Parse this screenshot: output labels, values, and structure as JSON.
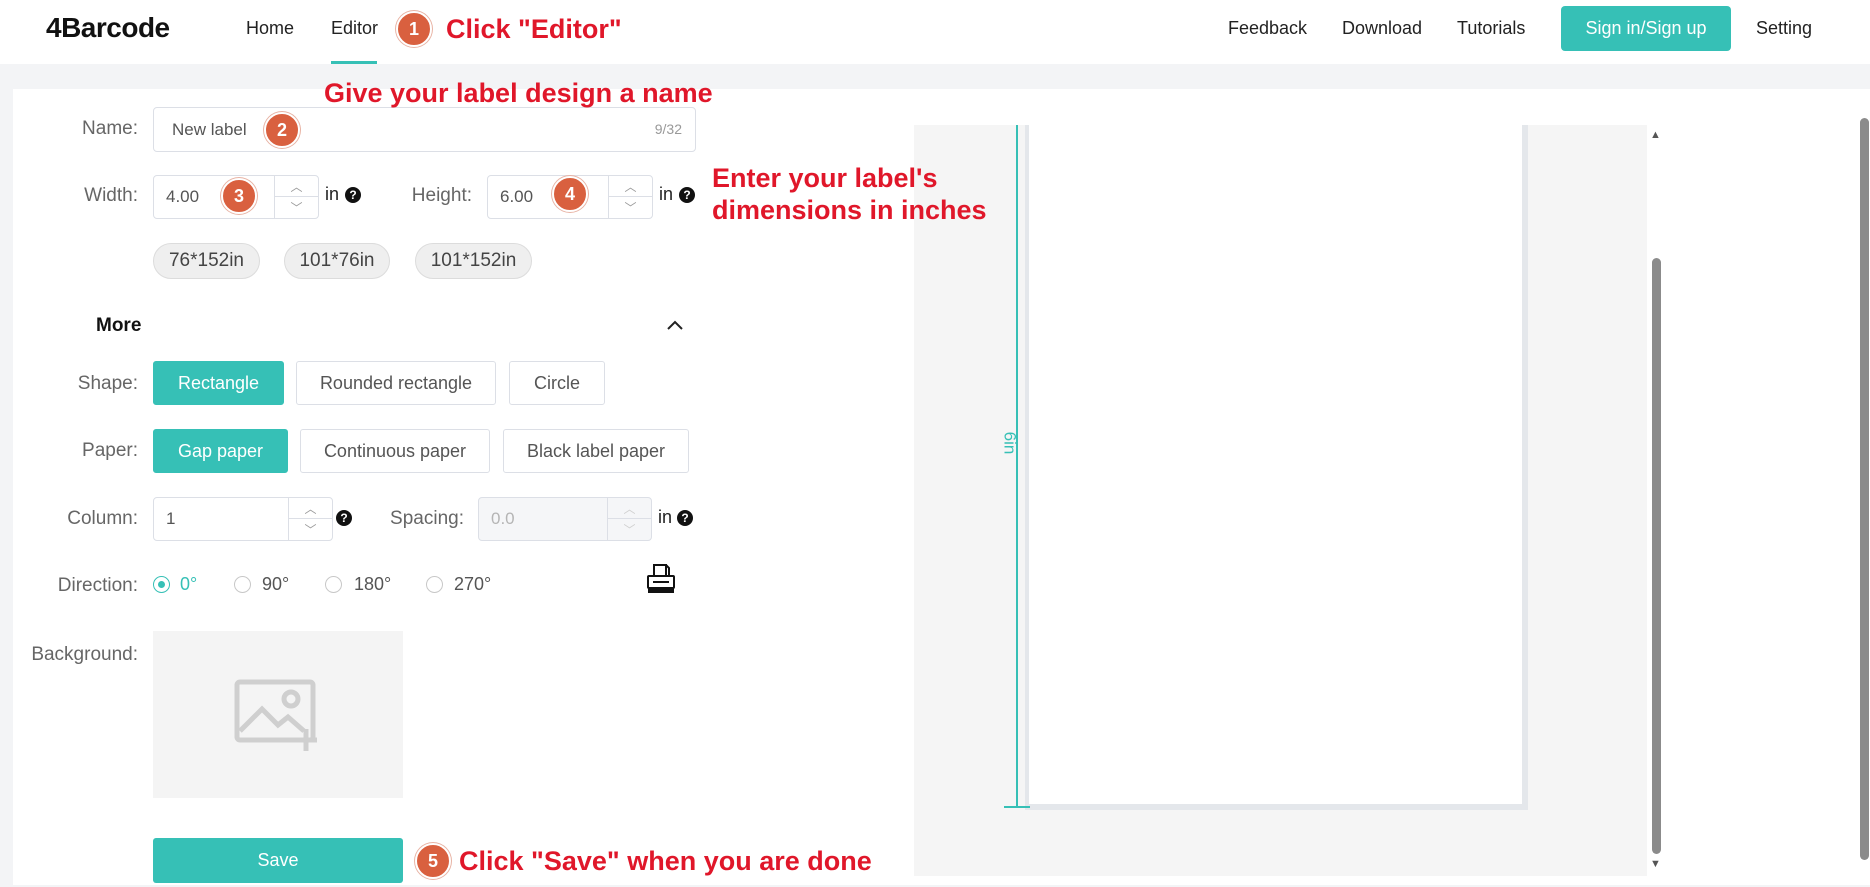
{
  "header": {
    "logo": "4Barcode",
    "nav_left": [
      "Home",
      "Editor"
    ],
    "nav_right": [
      "Feedback",
      "Download",
      "Tutorials"
    ],
    "sign_in": "Sign in/Sign up",
    "setting": "Setting"
  },
  "form": {
    "name_label": "Name:",
    "name_value": "New label",
    "name_count": "9/32",
    "width_label": "Width:",
    "width_value": "4.00",
    "height_label": "Height:",
    "height_value": "6.00",
    "unit": "in",
    "presets": [
      "76*152in",
      "101*76in",
      "101*152in"
    ],
    "more_label": "More",
    "shape_label": "Shape:",
    "shapes": [
      "Rectangle",
      "Rounded rectangle",
      "Circle"
    ],
    "paper_label": "Paper:",
    "papers": [
      "Gap paper",
      "Continuous paper",
      "Black label paper"
    ],
    "column_label": "Column:",
    "column_value": "1",
    "spacing_label": "Spacing:",
    "spacing_value": "0.0",
    "direction_label": "Direction:",
    "directions": [
      "0°",
      "90°",
      "180°",
      "270°"
    ],
    "background_label": "Background:",
    "save_label": "Save"
  },
  "preview": {
    "height_ruler": "6in"
  },
  "annotations": {
    "badges": [
      "1",
      "2",
      "3",
      "4",
      "5"
    ],
    "click_editor": "Click \"Editor\"",
    "name_hint": "Give your label design a name",
    "dimension_hint_1": "Enter your label's",
    "dimension_hint_2": "dimensions in inches",
    "save_hint": "Click \"Save\" when you are done"
  },
  "colors": {
    "accent": "#36c0b6",
    "annotation_text": "#e0172a",
    "badge": "#d9603f"
  },
  "icons": [
    "help-icon",
    "chevron-up-icon",
    "printer-icon",
    "image-add-icon"
  ]
}
